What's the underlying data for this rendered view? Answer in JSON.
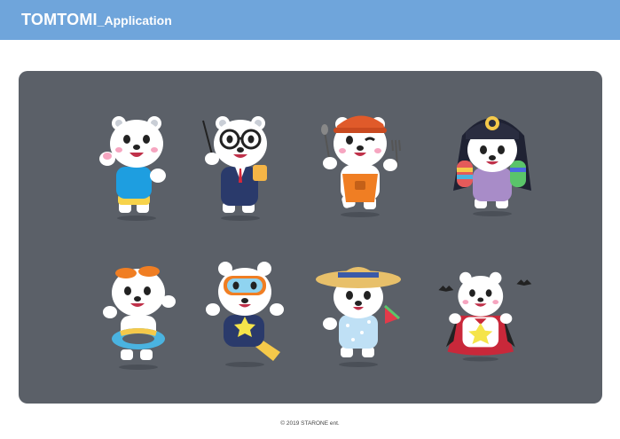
{
  "header": {
    "title_main": "TOMTOMI",
    "title_sub": "_Application",
    "background": "#6fa5db"
  },
  "panel": {
    "background": "#5b6068"
  },
  "characters": [
    {
      "name": "bear-basic-icon"
    },
    {
      "name": "bear-teacher-icon"
    },
    {
      "name": "bear-chef-icon"
    },
    {
      "name": "bear-traditional-icon"
    },
    {
      "name": "bear-swim-ring-icon"
    },
    {
      "name": "bear-snorkel-icon"
    },
    {
      "name": "bear-straw-hat-icon"
    },
    {
      "name": "bear-vampire-icon"
    }
  ],
  "footer": {
    "copyright": "© 2019 STARONE ent."
  }
}
